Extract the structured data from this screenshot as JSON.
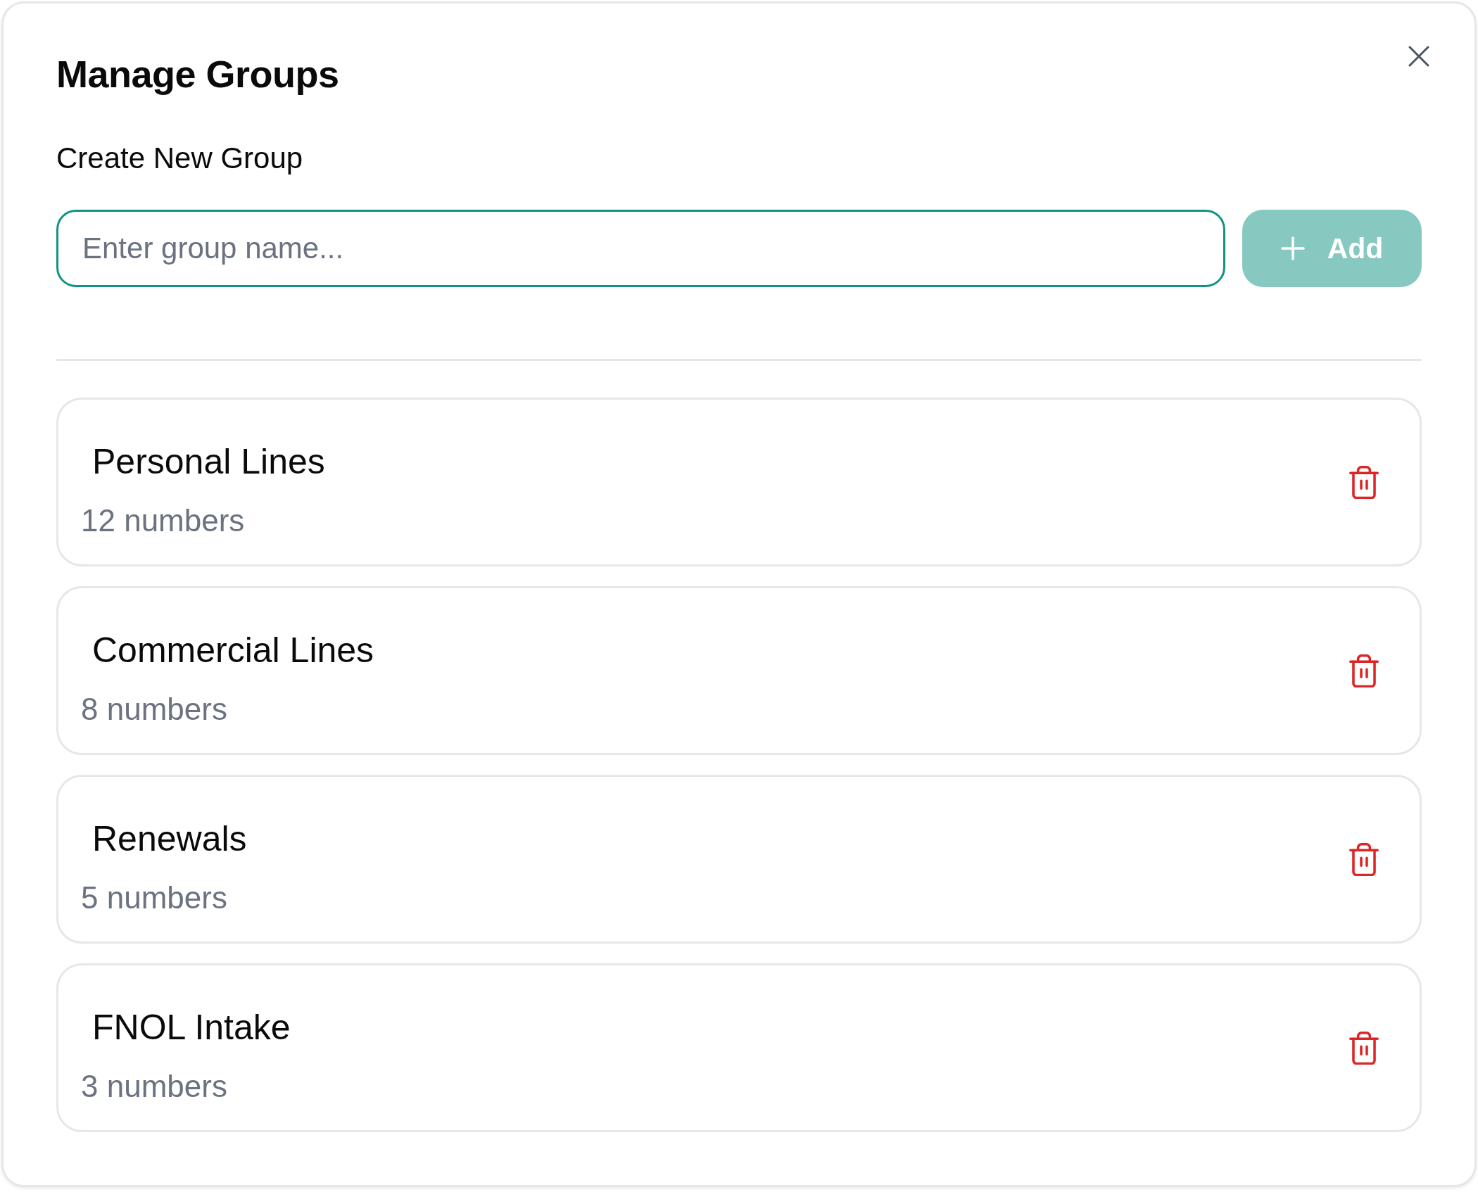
{
  "dialog": {
    "title": "Manage Groups"
  },
  "create_section": {
    "heading": "Create New Group",
    "input": {
      "placeholder": "Enter group name...",
      "focused": true
    },
    "add_button": {
      "label": "Add",
      "disabled": true
    }
  },
  "groups": [
    {
      "name": "Personal Lines",
      "count": "12 numbers"
    },
    {
      "name": "Commercial Lines",
      "count": "8 numbers"
    },
    {
      "name": "Renewals",
      "count": "5 numbers"
    },
    {
      "name": "FNOL Intake",
      "count": "3 numbers"
    }
  ]
}
